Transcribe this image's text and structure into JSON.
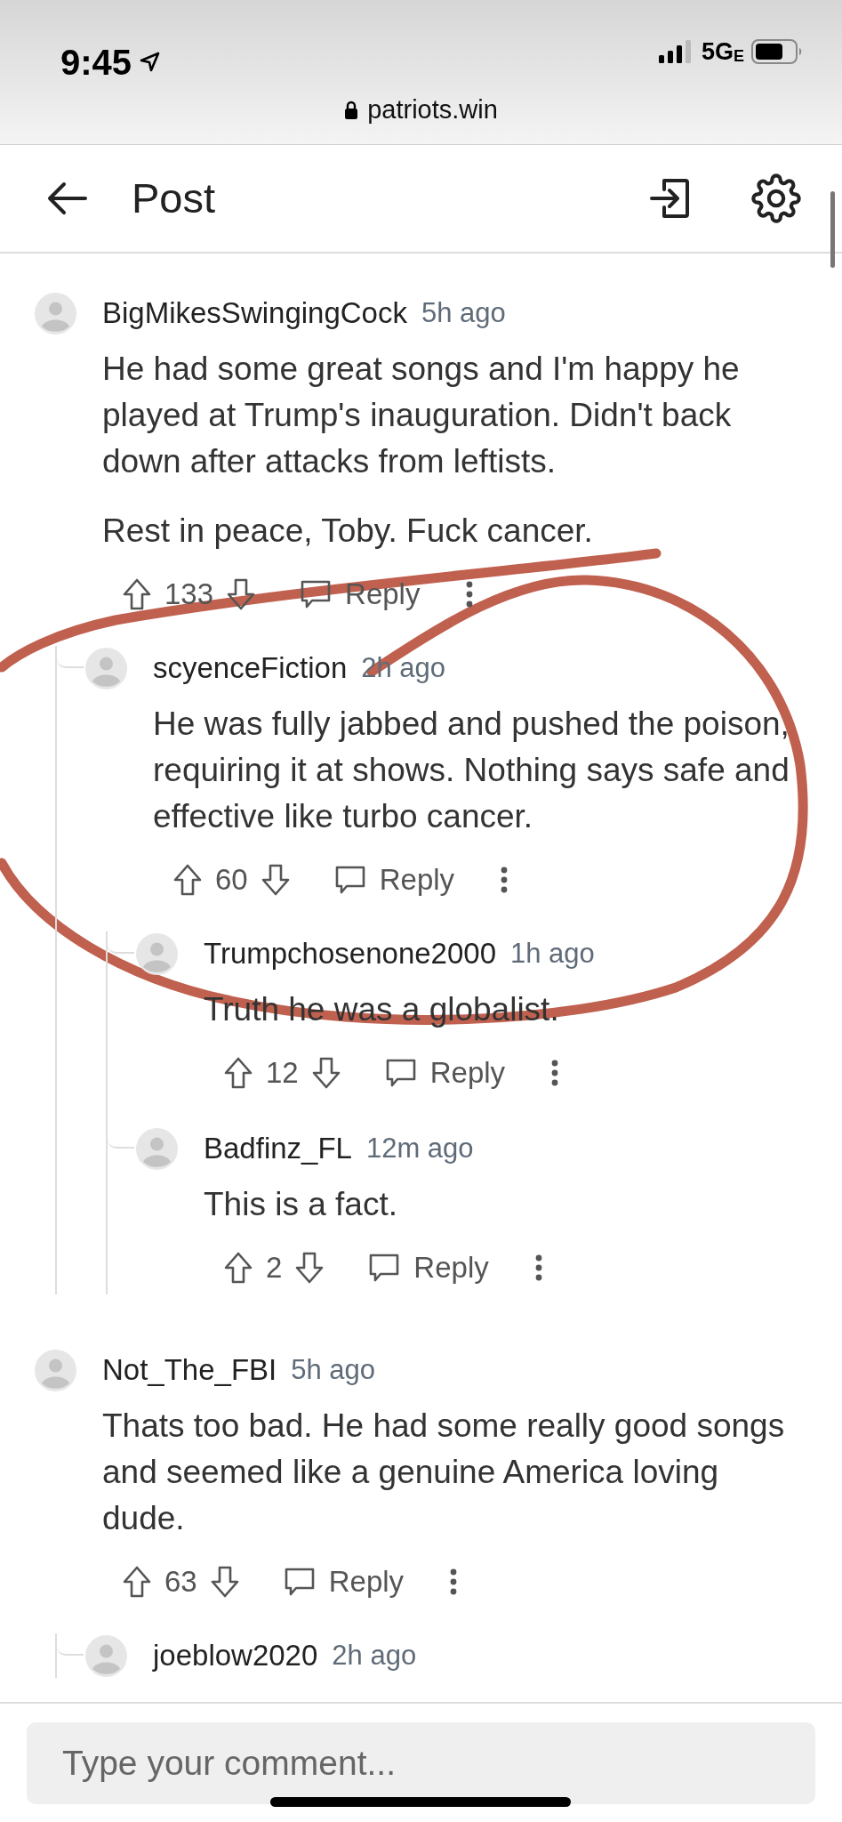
{
  "status_bar": {
    "time": "9:45",
    "network": "5G",
    "network_suffix": "E",
    "url": "patriots.win"
  },
  "header": {
    "title": "Post"
  },
  "comments": [
    {
      "user": "BigMikesSwingingCock",
      "time": "5h ago",
      "paragraphs": [
        "He had some great songs and I'm happy he played at Trump's inauguration. Didn't back down after attacks from leftists.",
        "Rest in peace, Toby. Fuck cancer."
      ],
      "score": "133",
      "reply_label": "Reply",
      "children": [
        {
          "user": "scyenceFiction",
          "time": "2h ago",
          "paragraphs": [
            "He was fully jabbed and pushed the poison, requiring it at shows. Nothing says safe and effective like turbo cancer."
          ],
          "score": "60",
          "reply_label": "Reply",
          "children": [
            {
              "user": "Trumpchosenone2000",
              "time": "1h ago",
              "paragraphs": [
                "Truth he was a globalist."
              ],
              "score": "12",
              "reply_label": "Reply"
            },
            {
              "user": "Badfinz_FL",
              "time": "12m ago",
              "paragraphs": [
                "This is a fact."
              ],
              "score": "2",
              "reply_label": "Reply"
            }
          ]
        }
      ]
    },
    {
      "user": "Not_The_FBI",
      "time": "5h ago",
      "paragraphs": [
        "Thats too bad. He had some really good songs and seemed like a genuine America loving dude."
      ],
      "score": "63",
      "reply_label": "Reply",
      "children": [
        {
          "user": "joeblow2020",
          "time": "2h ago"
        }
      ]
    }
  ],
  "comment_input": {
    "placeholder": "Type your comment..."
  }
}
